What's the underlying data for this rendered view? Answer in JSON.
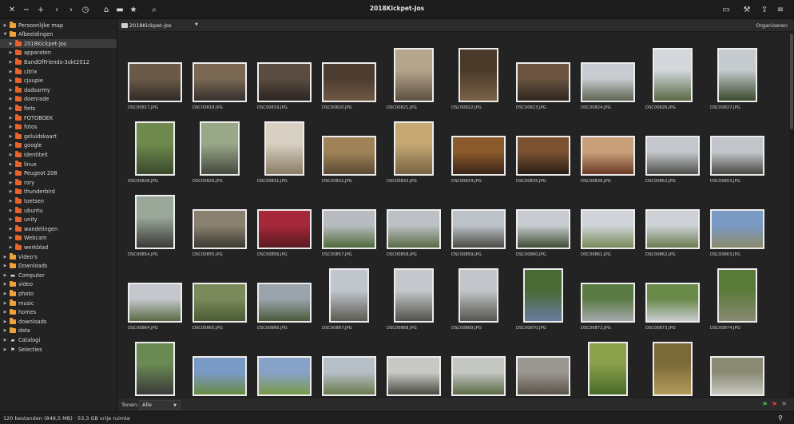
{
  "window": {
    "title": "2018Kickpet-Jos",
    "left_icons": [
      "close-icon",
      "minimize-icon",
      "maximize-icon",
      "back-icon",
      "forward-icon",
      "history-icon",
      "home-icon",
      "drive-icon",
      "bookmark-icon",
      "search-icon"
    ],
    "right_icons": [
      "preview-icon",
      "tools-icon",
      "share-icon",
      "menu-icon"
    ]
  },
  "sidebar": {
    "items": [
      {
        "label": "Persoonlijke map",
        "level": 0,
        "expanded": false,
        "icon": "user-folder"
      },
      {
        "label": "Afbeeldingen",
        "level": 0,
        "expanded": true,
        "icon": "user-folder"
      },
      {
        "label": "2018Kickpet-Jos",
        "level": 1,
        "expanded": false,
        "icon": "folder",
        "selected": true
      },
      {
        "label": "apparaten",
        "level": 1,
        "icon": "folder"
      },
      {
        "label": "BandOfFriends-3okt2012",
        "level": 1,
        "icon": "folder"
      },
      {
        "label": "citrix",
        "level": 1,
        "icon": "folder"
      },
      {
        "label": "cjuupie",
        "level": 1,
        "icon": "folder"
      },
      {
        "label": "dadsarmy",
        "level": 1,
        "icon": "folder"
      },
      {
        "label": "doenrade",
        "level": 1,
        "icon": "folder"
      },
      {
        "label": "fiets",
        "level": 1,
        "icon": "folder"
      },
      {
        "label": "FOTOBOEK",
        "level": 1,
        "icon": "folder"
      },
      {
        "label": "fotos",
        "level": 1,
        "icon": "folder"
      },
      {
        "label": "geluidskaart",
        "level": 1,
        "icon": "folder"
      },
      {
        "label": "google",
        "level": 1,
        "icon": "folder"
      },
      {
        "label": "identiteit",
        "level": 1,
        "icon": "folder"
      },
      {
        "label": "linux",
        "level": 1,
        "icon": "folder"
      },
      {
        "label": "Peugeot 208",
        "level": 1,
        "icon": "folder"
      },
      {
        "label": "rory",
        "level": 1,
        "icon": "folder"
      },
      {
        "label": "thunderbird",
        "level": 1,
        "icon": "folder"
      },
      {
        "label": "toetsen",
        "level": 1,
        "icon": "folder"
      },
      {
        "label": "ubuntu",
        "level": 1,
        "icon": "folder"
      },
      {
        "label": "unity",
        "level": 1,
        "icon": "folder"
      },
      {
        "label": "wandelingen",
        "level": 1,
        "icon": "folder"
      },
      {
        "label": "Webcam",
        "level": 1,
        "icon": "folder"
      },
      {
        "label": "werkblad",
        "level": 1,
        "icon": "folder"
      },
      {
        "label": "Video's",
        "level": 0,
        "icon": "user-folder"
      },
      {
        "label": "Downloads",
        "level": 0,
        "icon": "user-folder"
      },
      {
        "label": "Computer",
        "level": 0,
        "icon": "computer-icon"
      },
      {
        "label": "video",
        "level": 0,
        "icon": "user-folder"
      },
      {
        "label": "photo",
        "level": 0,
        "icon": "user-folder"
      },
      {
        "label": "music",
        "level": 0,
        "icon": "user-folder"
      },
      {
        "label": "homes",
        "level": 0,
        "icon": "user-folder"
      },
      {
        "label": "downloads",
        "level": 0,
        "icon": "user-folder"
      },
      {
        "label": "data",
        "level": 0,
        "icon": "user-folder"
      },
      {
        "label": "Catalogi",
        "level": 0,
        "icon": "catalog-icon"
      },
      {
        "label": "Selecties",
        "level": 0,
        "icon": "flag-icon"
      }
    ]
  },
  "pathbar": {
    "current": "2018Kickpet-Jos",
    "organise_label": "Organiseren"
  },
  "files": [
    {
      "name": "DSC00817.JPG",
      "orient": "l",
      "colors": [
        "#6b5a48",
        "#2f2a26"
      ]
    },
    {
      "name": "DSC00818.JPG",
      "orient": "l",
      "colors": [
        "#7a6854",
        "#34302c"
      ]
    },
    {
      "name": "DSC00819.JPG",
      "orient": "l",
      "colors": [
        "#5a4c40",
        "#2b2522"
      ]
    },
    {
      "name": "DSC00820.JPG",
      "orient": "l",
      "colors": [
        "#4d3d30",
        "#6e5844"
      ]
    },
    {
      "name": "DSC00821.JPG",
      "orient": "p",
      "colors": [
        "#b4a68c",
        "#5e5042"
      ]
    },
    {
      "name": "DSC00822.JPG",
      "orient": "p",
      "colors": [
        "#4a3a2a",
        "#7a6248"
      ]
    },
    {
      "name": "DSC00823.JPG",
      "orient": "l",
      "colors": [
        "#6a5440",
        "#2e2620"
      ]
    },
    {
      "name": "DSC00824.JPG",
      "orient": "l",
      "colors": [
        "#c8ccd0",
        "#5c6450"
      ]
    },
    {
      "name": "DSC00826.JPG",
      "orient": "p",
      "colors": [
        "#d4d8dc",
        "#5a6a46"
      ]
    },
    {
      "name": "DSC00827.JPG",
      "orient": "p",
      "colors": [
        "#c6cbcf",
        "#3a4a2e"
      ]
    },
    {
      "name": "DSC00828.JPG",
      "orient": "p",
      "colors": [
        "#6f8a4c",
        "#3a4a2c"
      ]
    },
    {
      "name": "DSC00829.JPG",
      "orient": "p",
      "colors": [
        "#9aa88a",
        "#454a40"
      ]
    },
    {
      "name": "DSC00831.JPG",
      "orient": "p",
      "colors": [
        "#d8d0c2",
        "#8c7c66"
      ]
    },
    {
      "name": "DSC00832.JPG",
      "orient": "l",
      "colors": [
        "#a08258",
        "#5a4a34"
      ]
    },
    {
      "name": "DSC00833.JPG",
      "orient": "p",
      "colors": [
        "#c6a874",
        "#7a6444"
      ]
    },
    {
      "name": "DSC00834.JPG",
      "orient": "l",
      "colors": [
        "#8a5a2a",
        "#3a2418"
      ]
    },
    {
      "name": "DSC00835.JPG",
      "orient": "l",
      "colors": [
        "#7a5232",
        "#2a1e16"
      ]
    },
    {
      "name": "DSC00836.JPG",
      "orient": "l",
      "colors": [
        "#c8a07a",
        "#6a3a24"
      ]
    },
    {
      "name": "DSC00852.JPG",
      "orient": "l",
      "colors": [
        "#c4c8cc",
        "#4e4e4a"
      ]
    },
    {
      "name": "DSC00853.JPG",
      "orient": "l",
      "colors": [
        "#c2c6ca",
        "#4a4a44"
      ]
    },
    {
      "name": "DSC00854.JPG",
      "orient": "p",
      "colors": [
        "#9aa89a",
        "#3a3a36"
      ]
    },
    {
      "name": "DSC00855.JPG",
      "orient": "l",
      "colors": [
        "#8a8070",
        "#3c3a32"
      ]
    },
    {
      "name": "DSC00856.JPG",
      "orient": "l",
      "colors": [
        "#a4283a",
        "#5a1a22"
      ]
    },
    {
      "name": "DSC00857.JPG",
      "orient": "l",
      "colors": [
        "#b8bcc0",
        "#4e6a3a"
      ]
    },
    {
      "name": "DSC00858.JPG",
      "orient": "l",
      "colors": [
        "#bcc0c4",
        "#5a6a44"
      ]
    },
    {
      "name": "DSC00859.JPG",
      "orient": "l",
      "colors": [
        "#bcc2c8",
        "#4a4a44"
      ]
    },
    {
      "name": "DSC00860.JPG",
      "orient": "l",
      "colors": [
        "#c8ccd0",
        "#3e4a32"
      ]
    },
    {
      "name": "DSC00861.JPG",
      "orient": "l",
      "colors": [
        "#d0d4d8",
        "#7a8a5a"
      ]
    },
    {
      "name": "DSC00862.JPG",
      "orient": "l",
      "colors": [
        "#ced2d6",
        "#6a7a4e"
      ]
    },
    {
      "name": "DSC00863.JPG",
      "orient": "l",
      "colors": [
        "#7a9ac4",
        "#8a8a6a"
      ]
    },
    {
      "name": "DSC00864.JPG",
      "orient": "l",
      "colors": [
        "#c4c8cc",
        "#5a6a44"
      ]
    },
    {
      "name": "DSC00865.JPG",
      "orient": "l",
      "colors": [
        "#7a8a5a",
        "#4a5a34"
      ]
    },
    {
      "name": "DSC00866.JPG",
      "orient": "l",
      "colors": [
        "#9aa4ac",
        "#4a5a3a"
      ]
    },
    {
      "name": "DSC00867.JPG",
      "orient": "p",
      "colors": [
        "#c0c6cc",
        "#5a5a50"
      ]
    },
    {
      "name": "DSC00868.JPG",
      "orient": "p",
      "colors": [
        "#c4c8cc",
        "#52524a"
      ]
    },
    {
      "name": "DSC00869.JPG",
      "orient": "p",
      "colors": [
        "#c2c6ca",
        "#56564e"
      ]
    },
    {
      "name": "DSC00870.JPG",
      "orient": "p",
      "colors": [
        "#4a6a34",
        "#6a7aa0"
      ]
    },
    {
      "name": "DSC00872.JPG",
      "orient": "l",
      "colors": [
        "#5a7a44",
        "#a4a8ac"
      ]
    },
    {
      "name": "DSC00873.JPG",
      "orient": "l",
      "colors": [
        "#6a8a4a",
        "#c8ccce"
      ]
    },
    {
      "name": "DSC00874.JPG",
      "orient": "p",
      "colors": [
        "#5a7a3a",
        "#8a8a74"
      ]
    },
    {
      "name": "DSC00877.JPG",
      "orient": "p",
      "colors": [
        "#6a8a54",
        "#3a3a38"
      ]
    },
    {
      "name": "DSC00878.JPG",
      "orient": "l",
      "colors": [
        "#7a9ac6",
        "#6a8a44"
      ]
    },
    {
      "name": "DSC00879.JPG",
      "orient": "l",
      "colors": [
        "#86a2c8",
        "#7a9a4a"
      ]
    },
    {
      "name": "DSC00880.JPG",
      "orient": "l",
      "colors": [
        "#b6bec6",
        "#6a7a4c"
      ]
    },
    {
      "name": "DSC00881.JPG",
      "orient": "l",
      "colors": [
        "#c8c8c4",
        "#4a4a42"
      ]
    },
    {
      "name": "DSC00882.JPG",
      "orient": "l",
      "colors": [
        "#c4c6c2",
        "#5a6a44"
      ]
    },
    {
      "name": "DSC00883.JPG",
      "orient": "l",
      "colors": [
        "#9a9690",
        "#5a5448"
      ]
    },
    {
      "name": "DSC00884.JPG",
      "orient": "p",
      "colors": [
        "#8aa04a",
        "#4a6a2a"
      ]
    },
    {
      "name": "DSC00885.JPG",
      "orient": "p",
      "colors": [
        "#7a6a3a",
        "#b49a5a"
      ]
    },
    {
      "name": "DSC00886.JPG",
      "orient": "l",
      "colors": [
        "#8a8a74",
        "#c8c8c0"
      ]
    }
  ],
  "filterbar": {
    "label": "Tonen:",
    "value": "Alle",
    "flag_colors": [
      "#3cae4a",
      "#d94040",
      "#6e6e6e"
    ]
  },
  "status": {
    "text": "120 bestanden (849,5 MB)  ·  53,3 GB vrije ruimte"
  }
}
